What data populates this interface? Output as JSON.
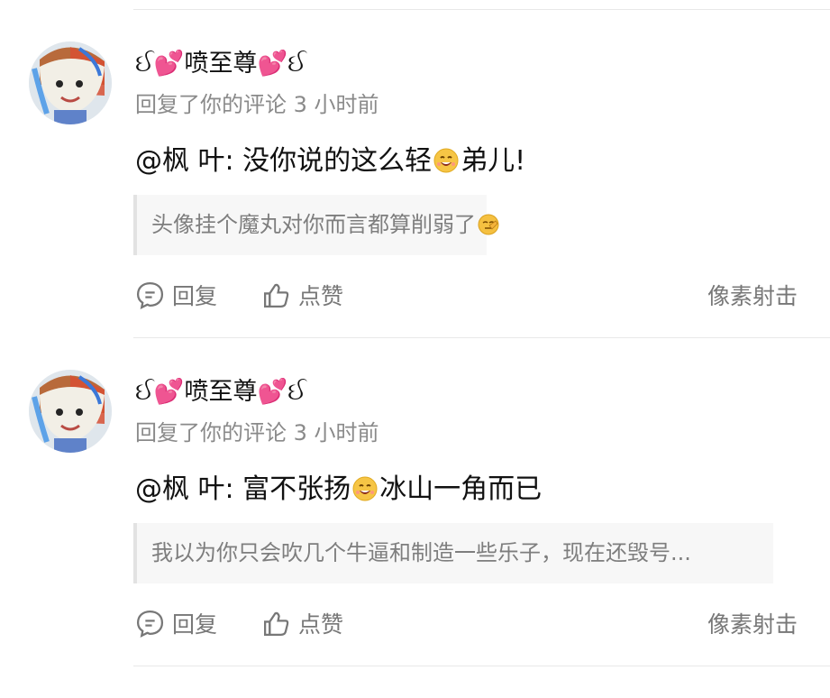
{
  "notifications": [
    {
      "username": "ઈ💕喷至尊💕ઈ",
      "meta": "回复了你的评论 3 小时前",
      "reply_prefix": "@枫 叶: 没你说的这么轻",
      "reply_suffix": "弟儿!",
      "quote_text": "头像挂个魔丸对你而言都算削弱了",
      "actions": {
        "reply": "回复",
        "like": "点赞",
        "shoot": "像素射击"
      }
    },
    {
      "username": "ઈ💕喷至尊💕ઈ",
      "meta": "回复了你的评论 3 小时前",
      "reply_prefix": "@枫 叶: 富不张扬",
      "reply_suffix": "冰山一角而已",
      "quote_text": "我以为你只会吹几个牛逼和制造一些乐子，现在还毁号...",
      "actions": {
        "reply": "回复",
        "like": "点赞",
        "shoot": "像素射击"
      }
    }
  ],
  "icons": {
    "comment": "comment-icon",
    "like": "thumbs-up-icon",
    "emoji": "laughing-emoji-icon",
    "quote_emoji": "facepalm-emoji-icon"
  },
  "colors": {
    "text": "#111111",
    "muted": "#8a8a8a",
    "divider": "#e8e8e8",
    "quote_bg": "#f7f7f7"
  }
}
